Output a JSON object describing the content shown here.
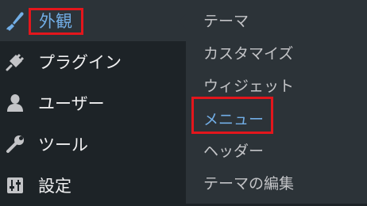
{
  "sidebar": {
    "items": [
      {
        "label": "外観",
        "icon": "paintbrush-icon"
      },
      {
        "label": "プラグイン",
        "icon": "plugin-icon"
      },
      {
        "label": "ユーザー",
        "icon": "user-icon"
      },
      {
        "label": "ツール",
        "icon": "wrench-icon"
      },
      {
        "label": "設定",
        "icon": "settings-icon"
      }
    ]
  },
  "submenu": {
    "items": [
      {
        "label": "テーマ"
      },
      {
        "label": "カスタマイズ"
      },
      {
        "label": "ウィジェット"
      },
      {
        "label": "メニュー"
      },
      {
        "label": "ヘッダー"
      },
      {
        "label": "テーマの編集"
      }
    ]
  },
  "colors": {
    "sidebar_bg": "#1d2327",
    "submenu_bg": "#2c3338",
    "accent": "#72aee6",
    "highlight": "#e3161c"
  }
}
